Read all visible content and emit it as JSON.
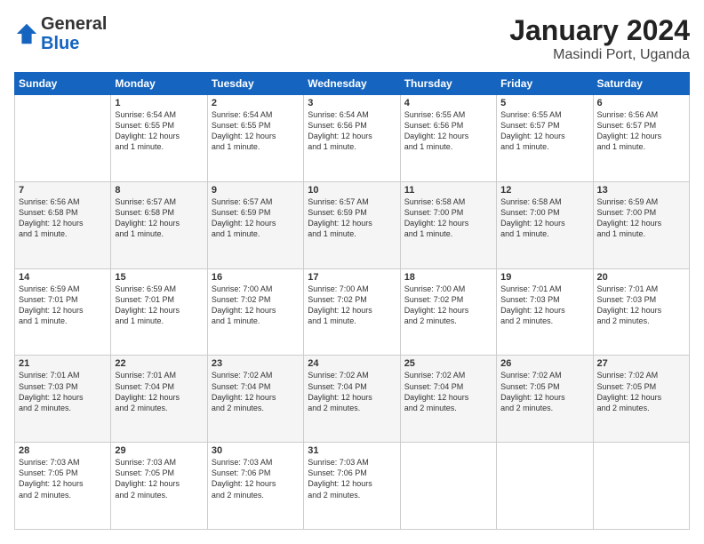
{
  "logo": {
    "general": "General",
    "blue": "Blue"
  },
  "title": "January 2024",
  "subtitle": "Masindi Port, Uganda",
  "days_of_week": [
    "Sunday",
    "Monday",
    "Tuesday",
    "Wednesday",
    "Thursday",
    "Friday",
    "Saturday"
  ],
  "weeks": [
    [
      {
        "day": "",
        "info": ""
      },
      {
        "day": "1",
        "info": "Sunrise: 6:54 AM\nSunset: 6:55 PM\nDaylight: 12 hours\nand 1 minute."
      },
      {
        "day": "2",
        "info": "Sunrise: 6:54 AM\nSunset: 6:55 PM\nDaylight: 12 hours\nand 1 minute."
      },
      {
        "day": "3",
        "info": "Sunrise: 6:54 AM\nSunset: 6:56 PM\nDaylight: 12 hours\nand 1 minute."
      },
      {
        "day": "4",
        "info": "Sunrise: 6:55 AM\nSunset: 6:56 PM\nDaylight: 12 hours\nand 1 minute."
      },
      {
        "day": "5",
        "info": "Sunrise: 6:55 AM\nSunset: 6:57 PM\nDaylight: 12 hours\nand 1 minute."
      },
      {
        "day": "6",
        "info": "Sunrise: 6:56 AM\nSunset: 6:57 PM\nDaylight: 12 hours\nand 1 minute."
      }
    ],
    [
      {
        "day": "7",
        "info": "Sunrise: 6:56 AM\nSunset: 6:58 PM\nDaylight: 12 hours\nand 1 minute."
      },
      {
        "day": "8",
        "info": "Sunrise: 6:57 AM\nSunset: 6:58 PM\nDaylight: 12 hours\nand 1 minute."
      },
      {
        "day": "9",
        "info": "Sunrise: 6:57 AM\nSunset: 6:59 PM\nDaylight: 12 hours\nand 1 minute."
      },
      {
        "day": "10",
        "info": "Sunrise: 6:57 AM\nSunset: 6:59 PM\nDaylight: 12 hours\nand 1 minute."
      },
      {
        "day": "11",
        "info": "Sunrise: 6:58 AM\nSunset: 7:00 PM\nDaylight: 12 hours\nand 1 minute."
      },
      {
        "day": "12",
        "info": "Sunrise: 6:58 AM\nSunset: 7:00 PM\nDaylight: 12 hours\nand 1 minute."
      },
      {
        "day": "13",
        "info": "Sunrise: 6:59 AM\nSunset: 7:00 PM\nDaylight: 12 hours\nand 1 minute."
      }
    ],
    [
      {
        "day": "14",
        "info": "Sunrise: 6:59 AM\nSunset: 7:01 PM\nDaylight: 12 hours\nand 1 minute."
      },
      {
        "day": "15",
        "info": "Sunrise: 6:59 AM\nSunset: 7:01 PM\nDaylight: 12 hours\nand 1 minute."
      },
      {
        "day": "16",
        "info": "Sunrise: 7:00 AM\nSunset: 7:02 PM\nDaylight: 12 hours\nand 1 minute."
      },
      {
        "day": "17",
        "info": "Sunrise: 7:00 AM\nSunset: 7:02 PM\nDaylight: 12 hours\nand 1 minute."
      },
      {
        "day": "18",
        "info": "Sunrise: 7:00 AM\nSunset: 7:02 PM\nDaylight: 12 hours\nand 2 minutes."
      },
      {
        "day": "19",
        "info": "Sunrise: 7:01 AM\nSunset: 7:03 PM\nDaylight: 12 hours\nand 2 minutes."
      },
      {
        "day": "20",
        "info": "Sunrise: 7:01 AM\nSunset: 7:03 PM\nDaylight: 12 hours\nand 2 minutes."
      }
    ],
    [
      {
        "day": "21",
        "info": "Sunrise: 7:01 AM\nSunset: 7:03 PM\nDaylight: 12 hours\nand 2 minutes."
      },
      {
        "day": "22",
        "info": "Sunrise: 7:01 AM\nSunset: 7:04 PM\nDaylight: 12 hours\nand 2 minutes."
      },
      {
        "day": "23",
        "info": "Sunrise: 7:02 AM\nSunset: 7:04 PM\nDaylight: 12 hours\nand 2 minutes."
      },
      {
        "day": "24",
        "info": "Sunrise: 7:02 AM\nSunset: 7:04 PM\nDaylight: 12 hours\nand 2 minutes."
      },
      {
        "day": "25",
        "info": "Sunrise: 7:02 AM\nSunset: 7:04 PM\nDaylight: 12 hours\nand 2 minutes."
      },
      {
        "day": "26",
        "info": "Sunrise: 7:02 AM\nSunset: 7:05 PM\nDaylight: 12 hours\nand 2 minutes."
      },
      {
        "day": "27",
        "info": "Sunrise: 7:02 AM\nSunset: 7:05 PM\nDaylight: 12 hours\nand 2 minutes."
      }
    ],
    [
      {
        "day": "28",
        "info": "Sunrise: 7:03 AM\nSunset: 7:05 PM\nDaylight: 12 hours\nand 2 minutes."
      },
      {
        "day": "29",
        "info": "Sunrise: 7:03 AM\nSunset: 7:05 PM\nDaylight: 12 hours\nand 2 minutes."
      },
      {
        "day": "30",
        "info": "Sunrise: 7:03 AM\nSunset: 7:06 PM\nDaylight: 12 hours\nand 2 minutes."
      },
      {
        "day": "31",
        "info": "Sunrise: 7:03 AM\nSunset: 7:06 PM\nDaylight: 12 hours\nand 2 minutes."
      },
      {
        "day": "",
        "info": ""
      },
      {
        "day": "",
        "info": ""
      },
      {
        "day": "",
        "info": ""
      }
    ]
  ]
}
